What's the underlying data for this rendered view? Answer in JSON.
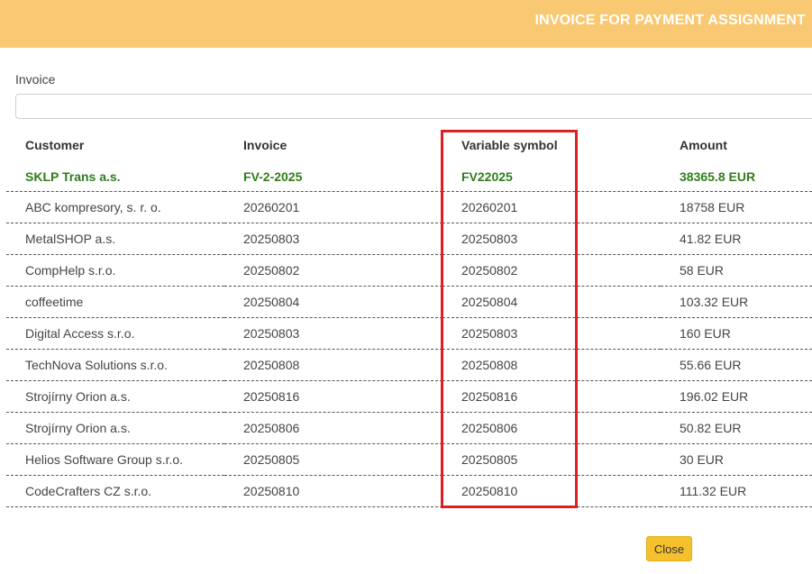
{
  "dialog": {
    "title": "INVOICE FOR PAYMENT ASSIGNMENT"
  },
  "invoice_field": {
    "label": "Invoice",
    "value": "",
    "placeholder": ""
  },
  "table": {
    "headers": {
      "customer": "Customer",
      "invoice": "Invoice",
      "variable_symbol": "Variable symbol",
      "amount": "Amount"
    },
    "selected_row": {
      "customer": "SKLP Trans a.s.",
      "invoice": "FV-2-2025",
      "variable_symbol": "FV22025",
      "amount": "38365.8 EUR"
    },
    "rows": [
      {
        "customer": "ABC kompresory, s. r. o.",
        "invoice": "20260201",
        "variable_symbol": "20260201",
        "amount": "18758 EUR"
      },
      {
        "customer": "MetalSHOP a.s.",
        "invoice": "20250803",
        "variable_symbol": "20250803",
        "amount": "41.82 EUR"
      },
      {
        "customer": "CompHelp s.r.o.",
        "invoice": "20250802",
        "variable_symbol": "20250802",
        "amount": "58 EUR"
      },
      {
        "customer": "coffeetime",
        "invoice": "20250804",
        "variable_symbol": "20250804",
        "amount": "103.32 EUR"
      },
      {
        "customer": "Digital Access s.r.o.",
        "invoice": "20250803",
        "variable_symbol": "20250803",
        "amount": "160 EUR"
      },
      {
        "customer": "TechNova Solutions s.r.o.",
        "invoice": "20250808",
        "variable_symbol": "20250808",
        "amount": "55.66 EUR"
      },
      {
        "customer": "Strojírny Orion a.s.",
        "invoice": "20250816",
        "variable_symbol": "20250816",
        "amount": "196.02 EUR"
      },
      {
        "customer": "Strojírny Orion a.s.",
        "invoice": "20250806",
        "variable_symbol": "20250806",
        "amount": "50.82 EUR"
      },
      {
        "customer": "Helios Software Group s.r.o.",
        "invoice": "20250805",
        "variable_symbol": "20250805",
        "amount": "30 EUR"
      },
      {
        "customer": "CodeCrafters CZ s.r.o.",
        "invoice": "20250810",
        "variable_symbol": "20250810",
        "amount": "111.32 EUR"
      }
    ]
  },
  "buttons": {
    "close_label": "Close"
  },
  "colors": {
    "header_background": "#f9c872",
    "selected_row_text": "#2e7d1a",
    "highlight_border": "#e02020",
    "close_button": "#f4c02d"
  }
}
